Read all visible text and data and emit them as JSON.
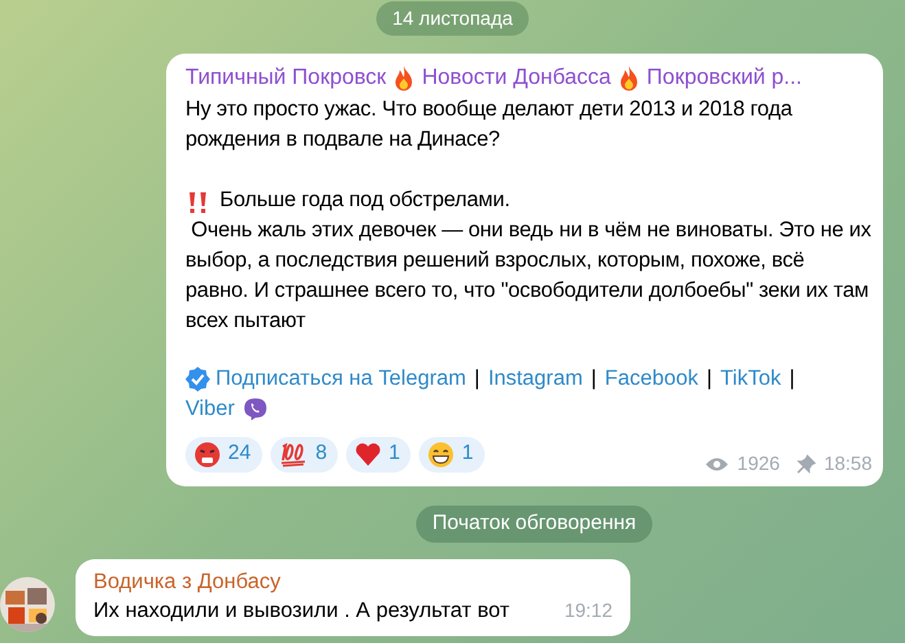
{
  "date_pill": "14 листопада",
  "post": {
    "channel_parts": [
      {
        "kind": "text",
        "text": "Типичный Покровск"
      },
      {
        "kind": "fire"
      },
      {
        "kind": "text",
        "text": "Новости Донбасса"
      },
      {
        "kind": "fire"
      },
      {
        "kind": "text",
        "text": "Покровский р..."
      }
    ],
    "paragraphs": [
      {
        "kind": "text",
        "text": "Ну это просто ужас. Что вообще делают дети 2013 и 2018 года рождения в подвале на Динасе?"
      },
      {
        "kind": "alert",
        "text": "Больше года под обстрелами."
      },
      {
        "kind": "text",
        "text": " Очень жаль этих девочек — они ведь ни в чём не виноваты. Это не их выбор, а последствия решений взрослых, которым, похоже, всё равно. И страшнее всего то, что \"освободители долбоебы\" зеки их там всех пытают"
      }
    ],
    "links": [
      {
        "kind": "verified-link",
        "text": "Подписаться на Telegram"
      },
      {
        "kind": "separator",
        "text": "|"
      },
      {
        "kind": "link",
        "text": "Instagram"
      },
      {
        "kind": "separator",
        "text": "|"
      },
      {
        "kind": "link",
        "text": "Facebook"
      },
      {
        "kind": "separator",
        "text": "|"
      },
      {
        "kind": "link",
        "text": "TikTok"
      },
      {
        "kind": "separator",
        "text": "|"
      },
      {
        "kind": "viber-link",
        "text": "Viber"
      }
    ],
    "reactions": [
      {
        "kind": "angry",
        "count": "24"
      },
      {
        "kind": "hundred",
        "count": "8"
      },
      {
        "kind": "heart",
        "count": "1"
      },
      {
        "kind": "grin",
        "count": "1"
      }
    ],
    "views": "1926",
    "time": "18:58"
  },
  "discussion_pill": "Початок обговорення",
  "comment": {
    "author": "Водичка з Донбасу",
    "text": "Их находили и вывозили . А результат вот",
    "time": "19:12"
  }
}
